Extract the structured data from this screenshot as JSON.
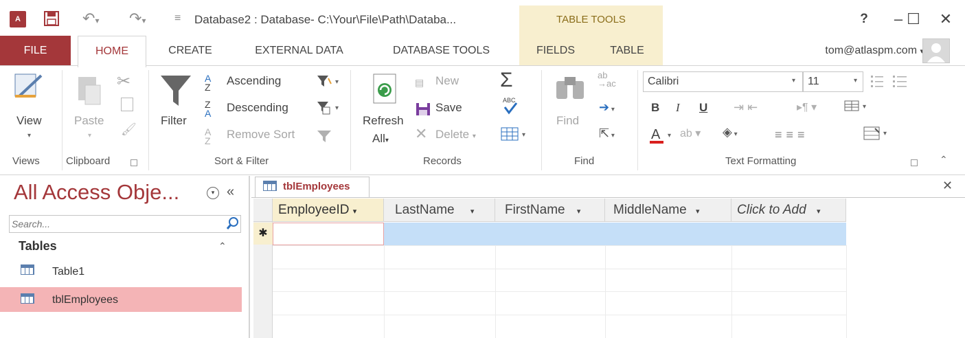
{
  "title_bar": {
    "app_icon_text": "A",
    "window_title": "Database2 : Database- C:\\Your\\File\\Path\\Databa...",
    "table_tools_label": "TABLE TOOLS",
    "help": "?",
    "minimize": "–",
    "restore": "☐",
    "close": "✕"
  },
  "tabs": {
    "file": "FILE",
    "home": "HOME",
    "create": "CREATE",
    "external_data": "EXTERNAL DATA",
    "database_tools": "DATABASE TOOLS",
    "fields": "FIELDS",
    "table": "TABLE"
  },
  "user": "tom@atlaspm.com",
  "ribbon": {
    "views": {
      "view": "View",
      "label": "Views"
    },
    "clipboard": {
      "paste": "Paste",
      "label": "Clipboard"
    },
    "sort_filter": {
      "filter": "Filter",
      "ascending": "Ascending",
      "descending": "Descending",
      "remove_sort": "Remove Sort",
      "label": "Sort & Filter"
    },
    "records": {
      "refresh": "Refresh",
      "all": "All",
      "new": "New",
      "save": "Save",
      "delete": "Delete",
      "label": "Records"
    },
    "find": {
      "find": "Find",
      "label": "Find"
    },
    "text_formatting": {
      "font": "Calibri",
      "size": "11",
      "bold": "B",
      "italic": "I",
      "underline": "U",
      "label": "Text Formatting"
    }
  },
  "nav_pane": {
    "title": "All Access Obje...",
    "search_placeholder": "Search...",
    "section": "Tables",
    "items": [
      "Table1",
      "tblEmployees"
    ]
  },
  "document": {
    "tab": "tblEmployees",
    "columns": [
      "EmployeeID",
      "LastName",
      "FirstName",
      "MiddleName",
      "Click to Add"
    ],
    "new_row_marker": "✱"
  },
  "colors": {
    "access_red": "#a4373a",
    "table_tools_band": "#f8efcf",
    "new_row_highlight": "#c5dff8",
    "selected_nav_item": "#f4b4b6"
  }
}
